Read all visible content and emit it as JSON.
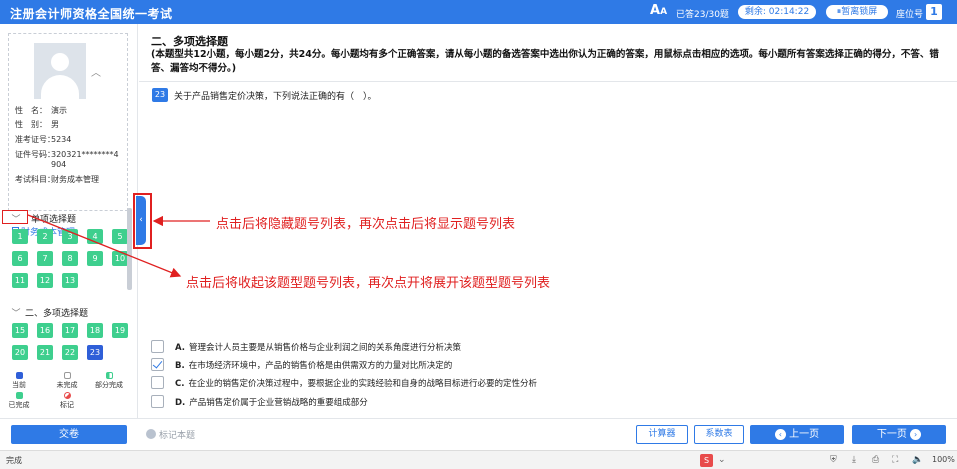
{
  "header": {
    "title": "注册会计师资格全国统一考试",
    "font_icon": "A",
    "font_icon_small": "A",
    "progress": "已答23/30题",
    "timer_label": "剩余:",
    "timer_value": "02:14:22",
    "leave_button": "暂离锁屏",
    "seat_label": "座位号",
    "seat_number": "1"
  },
  "candidate": {
    "name_label": "性　名：",
    "name": "演示",
    "gender_label": "性　别：",
    "gender": "男",
    "ticket_label": "准考证号：",
    "ticket": "5234",
    "id_label": "证件号码：",
    "id": "320321********4904",
    "subject_label": "考试科目：",
    "subject": "财务成本管理"
  },
  "sidebar": {
    "subject_link": "财务成本管理",
    "section1": {
      "title": "单项选择题",
      "questions": [
        "1",
        "2",
        "3",
        "4",
        "5",
        "6",
        "7",
        "8",
        "9",
        "10",
        "11",
        "12",
        "13"
      ]
    },
    "section2": {
      "title": "二、多项选择题",
      "questions": [
        "15",
        "16",
        "17",
        "18",
        "19",
        "20",
        "21",
        "22",
        "23"
      ],
      "current": "23"
    },
    "legend": {
      "current": "当前",
      "undone": "未完成",
      "partial": "部分完成",
      "done": "已完成",
      "marked": "标记"
    }
  },
  "main": {
    "section_title": "二、多项选择题",
    "instructions": "(本题型共12小题，每小题2分，共24分。每小题均有多个正确答案，请从每小题的备选答案中选出你认为正确的答案，用鼠标点击相应的选项。每小题所有答案选择正确的得分，不答、错答、漏答均不得分。)",
    "question_number": "23",
    "question_text": "关于产品销售定价决策，下列说法正确的有（　）。",
    "options": [
      {
        "letter": "A.",
        "text": "管理会计人员主要是从销售价格与企业利润之间的关系角度进行分析决策",
        "checked": false
      },
      {
        "letter": "B.",
        "text": "在市场经济环境中，产品的销售价格是由供需双方的力量对比所决定的",
        "checked": true
      },
      {
        "letter": "C.",
        "text": "在企业的销售定价决策过程中，要根据企业的实践经验和自身的战略目标进行必要的定性分析",
        "checked": false
      },
      {
        "letter": "D.",
        "text": "产品销售定价属于企业营销战略的重要组成部分",
        "checked": false
      }
    ]
  },
  "annotations": {
    "toggle_note": "点击后将隐藏题号列表，再次点击后将显示题号列表",
    "collapse_note": "点击后将收起该题型题号列表，再次点开将展开该题型题号列表",
    "color": "#e02020"
  },
  "footer": {
    "submit": "交卷",
    "mark": "标记本题",
    "calculator": "计算器",
    "coefficients": "系数表",
    "prev": "上一页",
    "next": "下一页"
  },
  "statusbar": {
    "text": "完成",
    "zoom": "100%"
  },
  "colors": {
    "primary": "#2f7ae6",
    "answered": "#3ecf8e",
    "current": "#2f5fd8",
    "annotation": "#e02020"
  }
}
